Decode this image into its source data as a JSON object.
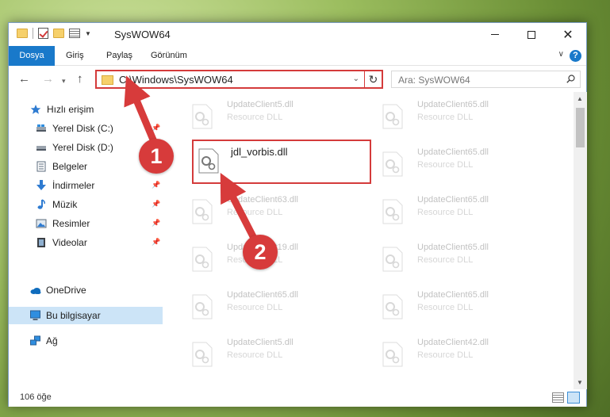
{
  "window": {
    "title": "SysWOW64",
    "min_symbol": "—",
    "close_symbol": "✕"
  },
  "ribbon": {
    "tabs": [
      {
        "label": "Dosya"
      },
      {
        "label": "Giriş"
      },
      {
        "label": "Paylaş"
      },
      {
        "label": "Görünüm"
      }
    ],
    "help": "?"
  },
  "nav": {
    "back": "←",
    "forward": "→",
    "recent": "▾",
    "up": "↑",
    "address": "C:\\Windows\\SysWOW64",
    "address_dropdown": "⌄",
    "refresh": "↻",
    "search_placeholder": "Ara: SysWOW64"
  },
  "sidebar": {
    "items": [
      {
        "label": "Hızlı erişim",
        "icon": "star-icon"
      },
      {
        "label": "Yerel Disk (C:)",
        "icon": "drive-icon",
        "pinned": true
      },
      {
        "label": "Yerel Disk (D:)",
        "icon": "drive-icon",
        "pinned": false
      },
      {
        "label": "Belgeler",
        "icon": "documents-icon",
        "pinned": false
      },
      {
        "label": "İndirmeler",
        "icon": "downloads-icon",
        "pinned": true
      },
      {
        "label": "Müzik",
        "icon": "music-icon",
        "pinned": true
      },
      {
        "label": "Resimler",
        "icon": "pictures-icon",
        "pinned": true
      },
      {
        "label": "Videolar",
        "icon": "videos-icon",
        "pinned": true
      },
      {
        "label": "OneDrive",
        "icon": "onedrive-icon"
      },
      {
        "label": "Bu bilgisayar",
        "icon": "this-pc-icon",
        "selected": true
      },
      {
        "label": "Ağ",
        "icon": "network-icon"
      }
    ],
    "pin_symbol": "📌"
  },
  "files": {
    "left_column": [
      {
        "name": "UpdateClient5.dll",
        "type": "Resource DLL"
      },
      {
        "name": "jdl_vorbis.dll",
        "type": ""
      },
      {
        "name": "UpdateClient63.dll",
        "type": "Resource DLL"
      },
      {
        "name": "UpdateClient19.dll",
        "type": "Resource DLL"
      },
      {
        "name": "UpdateClient65.dll",
        "type": "Resource DLL"
      },
      {
        "name": "UpdateClient5.dll",
        "type": "Resource DLL"
      }
    ],
    "right_column": [
      {
        "name": "UpdateClient65.dll",
        "type": "Resource DLL"
      },
      {
        "name": "UpdateClient65.dll",
        "type": "Resource DLL"
      },
      {
        "name": "UpdateClient65.dll",
        "type": "Resource DLL"
      },
      {
        "name": "UpdateClient65.dll",
        "type": "Resource DLL"
      },
      {
        "name": "UpdateClient65.dll",
        "type": "Resource DLL"
      },
      {
        "name": "UpdateClient42.dll",
        "type": "Resource DLL"
      }
    ]
  },
  "status": {
    "item_count": "106 öğe"
  },
  "callouts": [
    {
      "number": "1"
    },
    {
      "number": "2"
    }
  ],
  "colors": {
    "accent": "#1979ca",
    "highlight": "#d43b3b",
    "selected_bg": "#cce4f7"
  }
}
